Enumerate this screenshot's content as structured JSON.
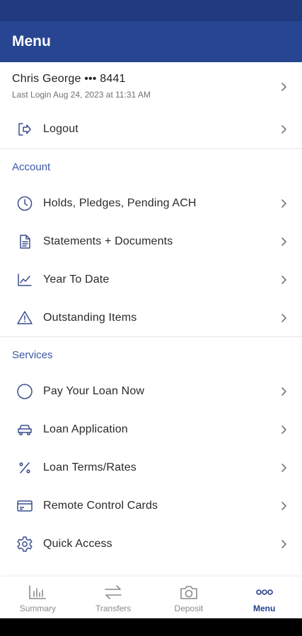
{
  "app": {
    "title": "Menu"
  },
  "user": {
    "name": "Chris George ••• 8441",
    "last_login": "Last Login Aug 24, 2023 at 11:31 AM"
  },
  "logout": {
    "label": "Logout",
    "icon": "logout-icon"
  },
  "account": {
    "header": "Account",
    "items": [
      {
        "label": "Holds, Pledges, Pending ACH",
        "icon": "clock-icon"
      },
      {
        "label": "Statements + Documents",
        "icon": "document-icon"
      },
      {
        "label": "Year To Date",
        "icon": "line-chart-icon"
      },
      {
        "label": "Outstanding Items",
        "icon": "warning-icon"
      }
    ]
  },
  "services": {
    "header": "Services",
    "items": [
      {
        "label": "Pay Your Loan Now",
        "icon": "circle-icon"
      },
      {
        "label": "Loan Application",
        "icon": "car-icon"
      },
      {
        "label": "Loan Terms/Rates",
        "icon": "percent-icon"
      },
      {
        "label": "Remote Control Cards",
        "icon": "card-icon"
      },
      {
        "label": "Quick Access",
        "icon": "gear-icon"
      }
    ]
  },
  "tabs": [
    {
      "label": "Summary",
      "icon": "bar-chart-icon",
      "active": false
    },
    {
      "label": "Transfers",
      "icon": "transfer-arrows-icon",
      "active": false
    },
    {
      "label": "Deposit",
      "icon": "camera-icon",
      "active": false
    },
    {
      "label": "Menu",
      "icon": "dots-icon",
      "active": true
    }
  ],
  "colors": {
    "header": "#284591",
    "status_bar": "#213a80",
    "accent": "#3c57a4",
    "active_tab": "#253f8c",
    "icon": "#3a4f8e"
  }
}
